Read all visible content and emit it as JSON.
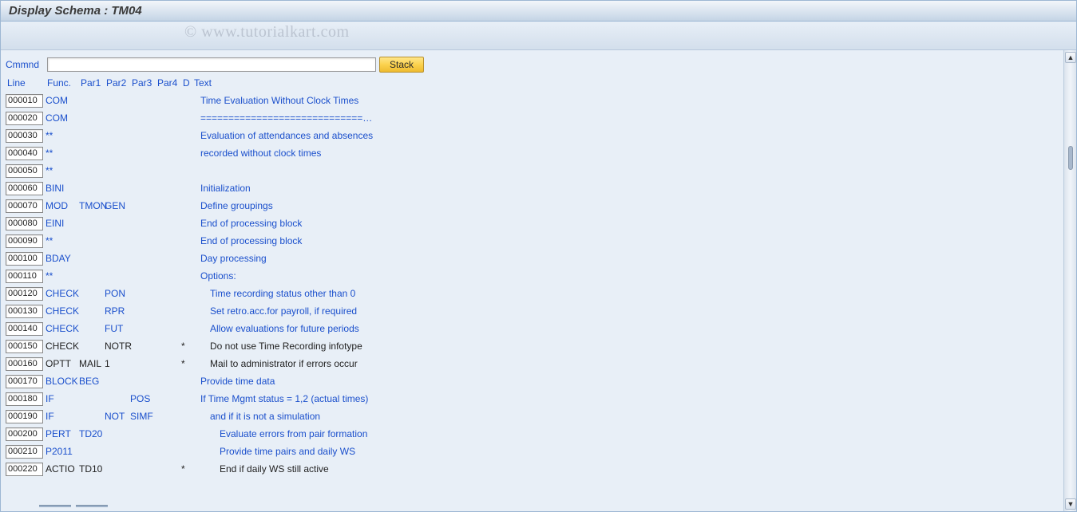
{
  "title": "Display Schema : TM04",
  "watermark": "© www.tutorialkart.com",
  "command": {
    "label": "Cmmnd",
    "value": "",
    "stack_btn": "Stack"
  },
  "headers": {
    "line": "Line",
    "func": "Func.",
    "par1": "Par1",
    "par2": "Par2",
    "par3": "Par3",
    "par4": "Par4",
    "d": "D",
    "text": "Text"
  },
  "rows": [
    {
      "line": "000010",
      "func": "COM",
      "par1": "",
      "par2": "",
      "par3": "",
      "par4": "",
      "d": "",
      "text": "Time Evaluation Without Clock Times",
      "indent": 0,
      "active": true
    },
    {
      "line": "000020",
      "func": "COM",
      "par1": "",
      "par2": "",
      "par3": "",
      "par4": "",
      "d": "",
      "text": "=============================…",
      "indent": 0,
      "active": true
    },
    {
      "line": "000030",
      "func": "**",
      "par1": "",
      "par2": "",
      "par3": "",
      "par4": "",
      "d": "",
      "text": "Evaluation of attendances and absences",
      "indent": 0,
      "active": true
    },
    {
      "line": "000040",
      "func": "**",
      "par1": "",
      "par2": "",
      "par3": "",
      "par4": "",
      "d": "",
      "text": "recorded without clock times",
      "indent": 0,
      "active": true
    },
    {
      "line": "000050",
      "func": "**",
      "par1": "",
      "par2": "",
      "par3": "",
      "par4": "",
      "d": "",
      "text": "",
      "indent": 0,
      "active": true
    },
    {
      "line": "000060",
      "func": "BINI",
      "par1": "",
      "par2": "",
      "par3": "",
      "par4": "",
      "d": "",
      "text": "Initialization",
      "indent": 0,
      "active": true
    },
    {
      "line": "000070",
      "func": "MOD",
      "par1": "TMON",
      "par2": "GEN",
      "par3": "",
      "par4": "",
      "d": "",
      "text": "Define groupings",
      "indent": 0,
      "active": true
    },
    {
      "line": "000080",
      "func": "EINI",
      "par1": "",
      "par2": "",
      "par3": "",
      "par4": "",
      "d": "",
      "text": "End of processing block",
      "indent": 0,
      "active": true
    },
    {
      "line": "000090",
      "func": "**",
      "par1": "",
      "par2": "",
      "par3": "",
      "par4": "",
      "d": "",
      "text": "End of processing block",
      "indent": 0,
      "active": true
    },
    {
      "line": "000100",
      "func": "BDAY",
      "par1": "",
      "par2": "",
      "par3": "",
      "par4": "",
      "d": "",
      "text": "Day processing",
      "indent": 0,
      "active": true
    },
    {
      "line": "000110",
      "func": "**",
      "par1": "",
      "par2": "",
      "par3": "",
      "par4": "",
      "d": "",
      "text": "Options:",
      "indent": 0,
      "active": true
    },
    {
      "line": "000120",
      "func": "CHECK",
      "par1": "",
      "par2": "PON",
      "par3": "",
      "par4": "",
      "d": "",
      "text": "Time recording status other than 0",
      "indent": 1,
      "active": true
    },
    {
      "line": "000130",
      "func": "CHECK",
      "par1": "",
      "par2": "RPR",
      "par3": "",
      "par4": "",
      "d": "",
      "text": "Set retro.acc.for payroll, if required",
      "indent": 1,
      "active": true
    },
    {
      "line": "000140",
      "func": "CHECK",
      "par1": "",
      "par2": "FUT",
      "par3": "",
      "par4": "",
      "d": "",
      "text": "Allow evaluations for future periods",
      "indent": 1,
      "active": true
    },
    {
      "line": "000150",
      "func": "CHECK",
      "par1": "",
      "par2": "NOTR",
      "par3": "",
      "par4": "",
      "d": "*",
      "text": "Do not use Time Recording infotype",
      "indent": 1,
      "active": false
    },
    {
      "line": "000160",
      "func": "OPTT",
      "par1": "MAIL",
      "par2": "1",
      "par3": "",
      "par4": "",
      "d": "*",
      "text": "Mail to administrator if errors occur",
      "indent": 1,
      "active": false
    },
    {
      "line": "000170",
      "func": "BLOCK",
      "par1": "BEG",
      "par2": "",
      "par3": "",
      "par4": "",
      "d": "",
      "text": "Provide time data",
      "indent": 0,
      "active": true
    },
    {
      "line": "000180",
      "func": "IF",
      "par1": "",
      "par2": "",
      "par3": "POS",
      "par4": "",
      "d": "",
      "text": "If Time Mgmt status = 1,2 (actual times)",
      "indent": 0,
      "active": true
    },
    {
      "line": "000190",
      "func": "IF",
      "par1": "",
      "par2": "NOT",
      "par3": "SIMF",
      "par4": "",
      "d": "",
      "text": "and if it is not a simulation",
      "indent": 1,
      "active": true
    },
    {
      "line": "000200",
      "func": "PERT",
      "par1": "TD20",
      "par2": "",
      "par3": "",
      "par4": "",
      "d": "",
      "text": "Evaluate errors from pair formation",
      "indent": 2,
      "active": true
    },
    {
      "line": "000210",
      "func": "P2011",
      "par1": "",
      "par2": "",
      "par3": "",
      "par4": "",
      "d": "",
      "text": "Provide time pairs and daily WS",
      "indent": 2,
      "active": true
    },
    {
      "line": "000220",
      "func": "ACTIO",
      "par1": "TD10",
      "par2": "",
      "par3": "",
      "par4": "",
      "d": "*",
      "text": "End if daily WS still active",
      "indent": 2,
      "active": false
    }
  ]
}
